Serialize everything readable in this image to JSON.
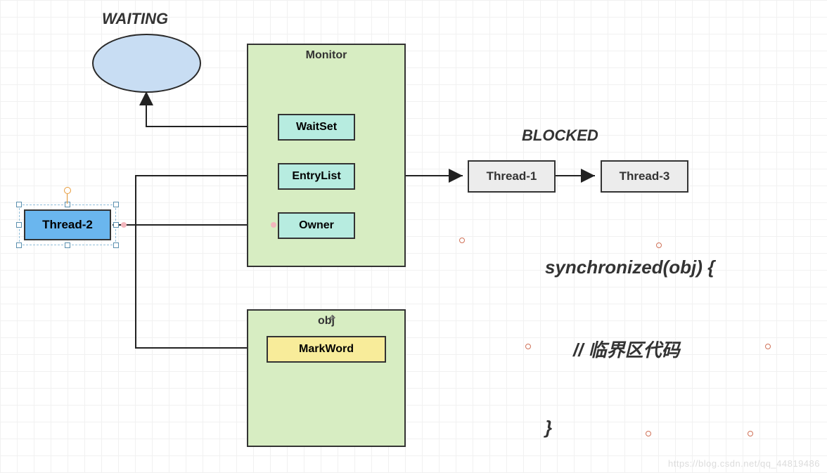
{
  "labels": {
    "waiting": "WAITING",
    "blocked": "BLOCKED"
  },
  "nodes": {
    "thread2": "Thread-2",
    "thread1": "Thread-1",
    "thread3": "Thread-3",
    "monitor_title": "Monitor",
    "waitset": "WaitSet",
    "entrylist": "EntryList",
    "owner": "Owner",
    "obj_title": "obj",
    "markword": "MarkWord"
  },
  "code": {
    "line1": "synchronized(obj) {",
    "line2": "// 临界区代码",
    "line3": "}"
  },
  "watermark": "https://blog.csdn.net/qq_44819486"
}
